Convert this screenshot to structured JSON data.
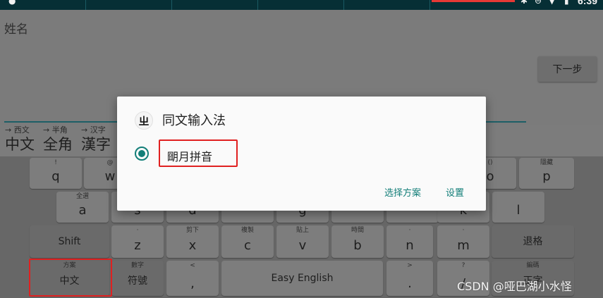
{
  "status_bar": {
    "time": "6:39",
    "left_icon": "android-notification-icon",
    "right_icons": [
      "bluetooth-icon",
      "do-not-disturb-icon",
      "wifi-icon",
      "battery-charging-icon"
    ]
  },
  "form": {
    "name_label": "姓名",
    "next_button": "下一步"
  },
  "candidates": [
    {
      "hint": "→ 西文",
      "main": "中文"
    },
    {
      "hint": "→ 半角",
      "main": "全角"
    },
    {
      "hint": "→ 汉字",
      "main": "漢字"
    }
  ],
  "keyboard": {
    "row1": [
      {
        "sub": "!",
        "label": "q"
      },
      {
        "sub": "@",
        "label": "w"
      },
      {
        "sub": "()",
        "label": "o"
      },
      {
        "sub": "隱藏",
        "label": "p"
      }
    ],
    "row2": [
      {
        "sub": "全選",
        "label": "a"
      },
      {
        "sub": "",
        "label": "s"
      },
      {
        "sub": "",
        "label": "d"
      },
      {
        "sub": "",
        "label": "g"
      },
      {
        "sub": "",
        "label": "k"
      },
      {
        "sub": "",
        "label": "l"
      }
    ],
    "row3": [
      {
        "sub": "",
        "label": "Shift"
      },
      {
        "sub": "·",
        "label": "z"
      },
      {
        "sub": "剪下",
        "label": "x"
      },
      {
        "sub": "複製",
        "label": "c"
      },
      {
        "sub": "貼上",
        "label": "v"
      },
      {
        "sub": "時間",
        "label": "b"
      },
      {
        "sub": "·",
        "label": "n"
      },
      {
        "sub": "·",
        "label": "m"
      },
      {
        "sub": "",
        "label": "退格"
      }
    ],
    "row4": [
      {
        "sub": "方案",
        "label": "中文"
      },
      {
        "sub": "數字",
        "label": "符號"
      },
      {
        "sub": "<",
        "label": ","
      },
      {
        "sub": "",
        "label": "Easy English"
      },
      {
        "sub": ">",
        "label": "."
      },
      {
        "sub": "?",
        "label": "/"
      },
      {
        "sub": "編碼",
        "label": "正字"
      }
    ]
  },
  "dialog": {
    "icon_glyph": "ㄓ",
    "title": "同文输入法",
    "option_label": "朙月拼音",
    "option_selected": true,
    "select_scheme_button": "选择方案",
    "settings_button": "设置"
  },
  "watermark": "CSDN @哑巴湖小水怪",
  "colors": {
    "accent": "#127e78",
    "highlight": "#e02020",
    "status_bar": "#062f35"
  }
}
